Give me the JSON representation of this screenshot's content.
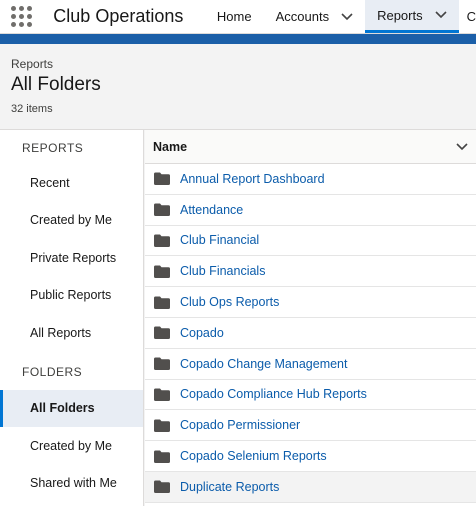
{
  "nav": {
    "app_name": "Club Operations",
    "items": [
      {
        "label": "Home"
      },
      {
        "label": "Accounts"
      },
      {
        "label": "Reports"
      },
      {
        "label": "C"
      }
    ]
  },
  "header": {
    "breadcrumb": "Reports",
    "title": "All Folders",
    "count": "32 items"
  },
  "sidebar": {
    "reports_section": "REPORTS",
    "report_items": [
      {
        "label": "Recent"
      },
      {
        "label": "Created by Me"
      },
      {
        "label": "Private Reports"
      },
      {
        "label": "Public Reports"
      },
      {
        "label": "All Reports"
      }
    ],
    "folders_section": "FOLDERS",
    "folder_items": [
      {
        "label": "All Folders"
      },
      {
        "label": "Created by Me"
      },
      {
        "label": "Shared with Me"
      }
    ]
  },
  "table": {
    "column_name": "Name",
    "rows": [
      {
        "name": "Annual Report Dashboard"
      },
      {
        "name": "Attendance"
      },
      {
        "name": "Club Financial"
      },
      {
        "name": "Club Financials"
      },
      {
        "name": "Club Ops Reports"
      },
      {
        "name": "Copado"
      },
      {
        "name": "Copado Change Management"
      },
      {
        "name": "Copado Compliance Hub Reports"
      },
      {
        "name": "Copado Permissioner"
      },
      {
        "name": "Copado Selenium Reports"
      },
      {
        "name": "Duplicate Reports"
      }
    ]
  },
  "colors": {
    "brand_stripe": "#1b5fa8",
    "accent": "#0176d3",
    "link": "#0b5cab"
  }
}
